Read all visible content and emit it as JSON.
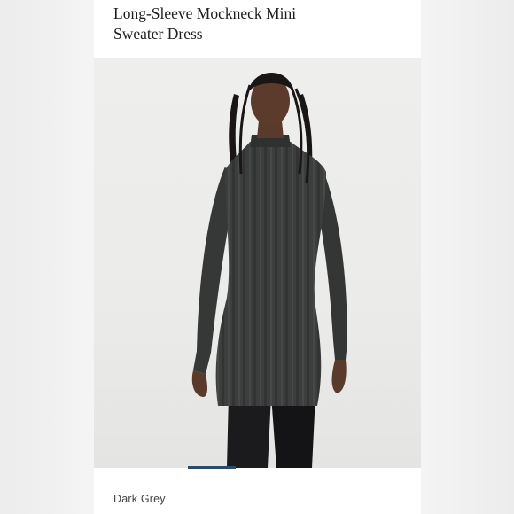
{
  "product": {
    "title_line1": "Long-Sleeve Mockneck Mini",
    "title_line2": "Sweater Dress",
    "color": "Dark Grey"
  }
}
